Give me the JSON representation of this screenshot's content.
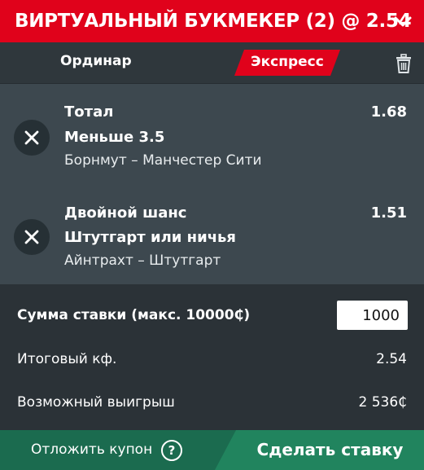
{
  "header": {
    "title": "ВИРТУАЛЬНЫЙ БУКМЕКЕР (2) @ 2.54",
    "accent_color": "#e0021b",
    "collapse_icon": "chevron-down-icon"
  },
  "tabs": {
    "single_label": "Ординар",
    "express_label": "Экспресс",
    "active": "Экспресс",
    "clear_icon": "trash-icon"
  },
  "bets": [
    {
      "market": "Тотал",
      "outcome": "Меньше 3.5",
      "event": "Борнмут – Манчестер Сити",
      "odds": "1.68",
      "remove_icon": "close-icon"
    },
    {
      "market": "Двойной шанс",
      "outcome": "Штутгарт или ничья",
      "event": "Айнтрахт – Штутгарт",
      "odds": "1.51",
      "remove_icon": "close-icon"
    }
  ],
  "summary": {
    "stake_label": "Сумма ставки (макс. 10000₵)",
    "stake_value": "1000",
    "total_odds_label": "Итоговый кф.",
    "total_odds_value": "2.54",
    "possible_win_label": "Возможный выигрыш",
    "possible_win_value": "2 536₵"
  },
  "footer": {
    "defer_label": "Отложить купон",
    "help_glyph": "?",
    "place_bet_label": "Сделать ставку",
    "defer_color": "#1b6b4f",
    "place_color": "#21845e"
  }
}
